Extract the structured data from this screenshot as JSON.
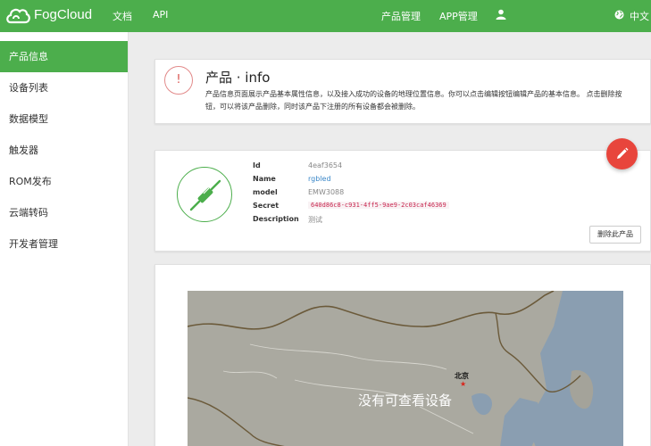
{
  "navbar": {
    "brand": "FogCloud",
    "links": [
      "文档",
      "API"
    ],
    "right_links": [
      "产品管理",
      "APP管理"
    ],
    "language": "中文",
    "color": "#4cae4c"
  },
  "sidebar": {
    "items": [
      {
        "label": "产品信息",
        "active": true
      },
      {
        "label": "设备列表"
      },
      {
        "label": "数据模型"
      },
      {
        "label": "触发器"
      },
      {
        "label": "ROM发布"
      },
      {
        "label": "云端转码"
      },
      {
        "label": "开发者管理"
      }
    ]
  },
  "info": {
    "icon": "!",
    "title": "产品 · info",
    "description": "产品信息页面展示产品基本属性信息，以及接入成功的设备的地理位置信息。你可以点击编辑按钮编辑产品的基本信息。 点击删除按钮，可以将该产品删除，同时该产品下注册的所有设备都会被删除。"
  },
  "product": {
    "fields": [
      {
        "label": "Id",
        "value": "4eaf3654"
      },
      {
        "label": "Name",
        "value": "rgbled"
      },
      {
        "label": "model",
        "value": "EMW3088"
      },
      {
        "label": "Secret",
        "value": "640d86c8-c931-4ff5-9ae9-2c03caf46369"
      },
      {
        "label": "Description",
        "value": "测试"
      }
    ],
    "delete_label": "删除此产品"
  },
  "map": {
    "city": "北京",
    "star": "★",
    "message": "没有可查看设备"
  },
  "colors": {
    "accent": "#4cae4c",
    "danger": "#e8453c",
    "link": "#3a87c8"
  },
  "icons": [
    "cloud-logo-icon",
    "user-icon",
    "globe-icon",
    "exclamation-icon",
    "plug-icon",
    "pencil-icon"
  ]
}
